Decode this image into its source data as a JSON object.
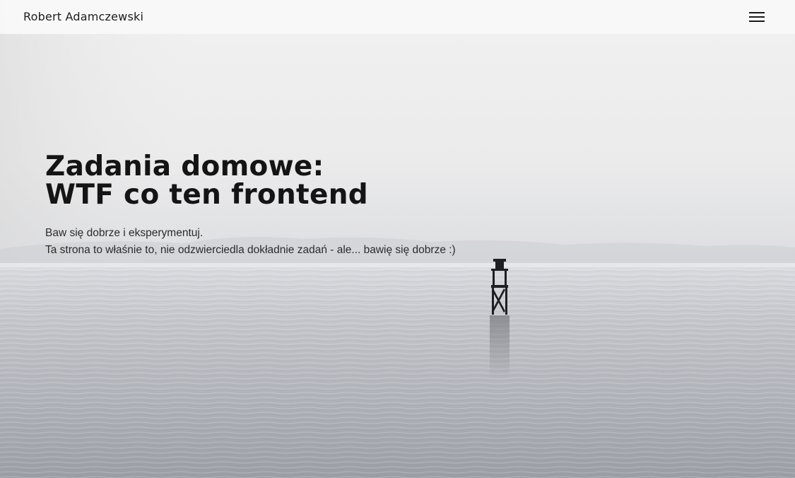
{
  "header": {
    "brand": "Robert Adamczewski",
    "menu_icon": "hamburger-menu-icon"
  },
  "hero": {
    "title_line1": "Zadania domowe:",
    "title_line2": "WTF co ten frontend",
    "subtitle_line1": "Baw się dobrze i eksperymentuj.",
    "subtitle_line2": "Ta strona to właśnie to, nie odzwierciedla dokładnie zadań - ale... bawię się dobrze :)"
  },
  "colors": {
    "navbar_bg": "#f8f8f8",
    "text_dark": "#141414",
    "sky": "#f2f2f2",
    "sea": "#a9acb3"
  }
}
